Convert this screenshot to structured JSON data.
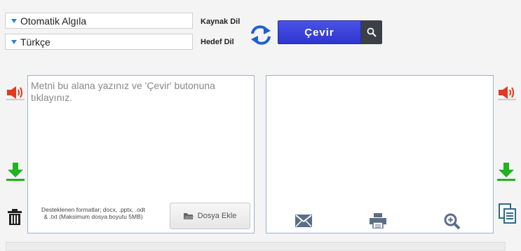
{
  "source_lang": {
    "value": "Otomatik Algıla",
    "label": "Kaynak Dil"
  },
  "target_lang": {
    "value": "Türkçe",
    "label": "Hedef Dil"
  },
  "translate_button": "Çevir",
  "input": {
    "placeholder": "Metni bu alana yazınız ve 'Çevir' butonuna tıklayınız.",
    "formats_line1": "Desteklenen formatlar; docx, .pptx, .odt",
    "formats_line2": "& .txt (Maksimum dosya boyutu 5MB)",
    "file_button": "Dosya Ekle"
  },
  "icons": [
    "swap-languages-icon",
    "search-icon",
    "speaker-icon",
    "download-icon",
    "trash-icon",
    "copy-icon",
    "mail-icon",
    "print-icon",
    "zoom-icon",
    "folder-icon"
  ],
  "colors": {
    "accent": "#3a41dc",
    "speaker": "#e03a20",
    "download": "#1fb31f",
    "swap": "#1f5fd6",
    "border": "#9fb2c5"
  }
}
